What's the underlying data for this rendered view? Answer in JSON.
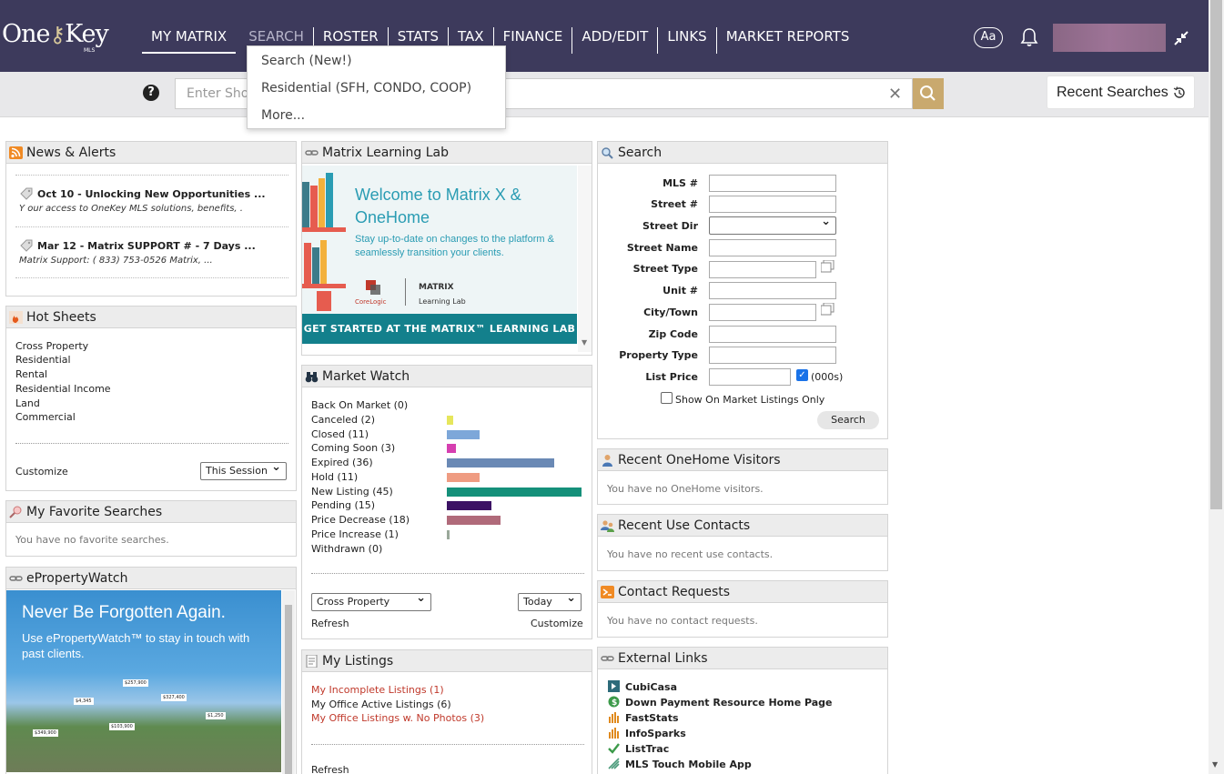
{
  "header": {
    "logo_text": "One",
    "logo_text2": "Key",
    "logo_sub": "MLS",
    "nav": [
      "MY MATRIX",
      "SEARCH",
      "ROSTER",
      "STATS",
      "TAX",
      "FINANCE",
      "ADD/EDIT",
      "LINKS",
      "MARKET REPORTS"
    ],
    "font_toggle": "Aa"
  },
  "search_strip": {
    "help": "?",
    "placeholder": "Enter Sho",
    "clear": "✕",
    "recent_label": "Recent Searches"
  },
  "search_menu": [
    "Search (New!)",
    "Residential (SFH, CONDO, COOP)",
    "More..."
  ],
  "news": {
    "title": "News & Alerts",
    "items": [
      {
        "title": "Oct 10 - Unlocking New Opportunities ...",
        "body": "Y our access to OneKey MLS solutions, benefits, ."
      },
      {
        "title": "Mar 12 - Matrix SUPPORT # - 7 Days ...",
        "body": "Matrix Support: ( 833) 753-0526 Matrix, ..."
      }
    ]
  },
  "hot_sheets": {
    "title": "Hot Sheets",
    "items": [
      "Cross Property",
      "Residential",
      "Rental",
      "Residential Income",
      "Land",
      "Commercial"
    ],
    "customize": "Customize",
    "session": "This Session"
  },
  "fav_searches": {
    "title": "My Favorite Searches",
    "empty": "You have no favorite searches."
  },
  "epw": {
    "title": "ePropertyWatch",
    "headline": "Never Be Forgotten Again.",
    "sub": "Use ePropertyWatch™ to stay in touch with past clients.",
    "prices": [
      "$257,900",
      "$4,345",
      "$327,400",
      "$1,250",
      "$349,900",
      "$103,900"
    ]
  },
  "learning_lab": {
    "title": "Matrix Learning Lab",
    "welcome": "Welcome to Matrix X & OneHome",
    "sub": "Stay up-to-date on changes to the platform & seamlessly transition your clients.",
    "logo1": "CoreLogic",
    "logo2": "MATRIX",
    "logo3": "Learning Lab",
    "cta": "GET STARTED AT THE MATRIX™ LEARNING LAB"
  },
  "market_watch": {
    "title": "Market Watch",
    "items": [
      {
        "label": "Back On Market (0)",
        "value": 0,
        "color": "#ffffff"
      },
      {
        "label": "Canceled (2)",
        "value": 2,
        "color": "#e6e65c"
      },
      {
        "label": "Closed (11)",
        "value": 11,
        "color": "#7da7d9"
      },
      {
        "label": "Coming Soon (3)",
        "value": 3,
        "color": "#d63fb0"
      },
      {
        "label": "Expired (36)",
        "value": 36,
        "color": "#6a89b5"
      },
      {
        "label": "Hold (11)",
        "value": 11,
        "color": "#ef9c82"
      },
      {
        "label": "New Listing (45)",
        "value": 45,
        "color": "#15907a"
      },
      {
        "label": "Pending (15)",
        "value": 15,
        "color": "#3c1264"
      },
      {
        "label": "Price Decrease (18)",
        "value": 18,
        "color": "#b06a7a"
      },
      {
        "label": "Price Increase (1)",
        "value": 1,
        "color": "#9aa89a"
      },
      {
        "label": "Withdrawn (0)",
        "value": 0,
        "color": "#ffffff"
      }
    ],
    "property_select": "Cross Property",
    "period_select": "Today",
    "refresh": "Refresh",
    "customize": "Customize"
  },
  "my_listings": {
    "title": "My Listings",
    "items": [
      {
        "label": "My Incomplete Listings (1)",
        "color": "#c0392b"
      },
      {
        "label": "My Office Active Listings (6)",
        "color": "#222222"
      },
      {
        "label": "My Office Listings w. No Photos (3)",
        "color": "#c0392b"
      }
    ],
    "refresh": "Refresh"
  },
  "search_form": {
    "title": "Search",
    "fields": [
      "MLS #",
      "Street #",
      "Street Dir",
      "Street Name",
      "Street Type",
      "Unit #",
      "City/Town",
      "Zip Code",
      "Property Type",
      "List Price"
    ],
    "thousands": "(000s)",
    "on_market": "Show On Market Listings Only",
    "search_btn": "Search"
  },
  "onehome": {
    "title": "Recent OneHome Visitors",
    "empty": "You have no OneHome visitors."
  },
  "contacts": {
    "title": "Recent Use Contacts",
    "empty": "You have no recent use contacts."
  },
  "requests": {
    "title": "Contact Requests",
    "empty": "You have no contact requests."
  },
  "external": {
    "title": "External Links",
    "items": [
      "CubiCasa",
      "Down Payment Resource Home Page",
      "FastStats",
      "InfoSparks",
      "ListTrac",
      "MLS Touch Mobile App"
    ]
  }
}
